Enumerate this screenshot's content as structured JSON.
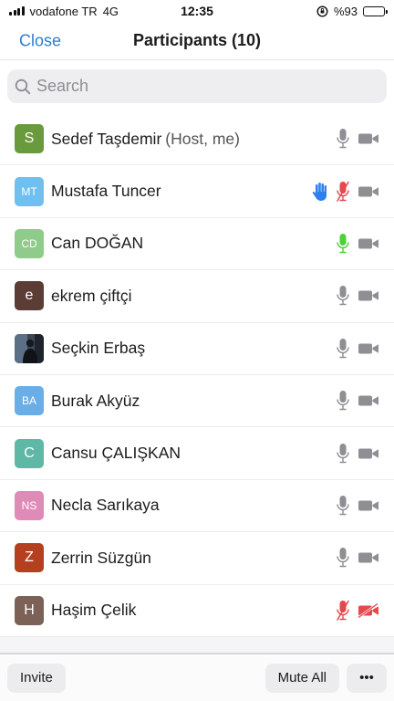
{
  "status_bar": {
    "carrier": "vodafone TR",
    "network": "4G",
    "time": "12:35",
    "battery": "%93",
    "battery_level": 0.93
  },
  "nav": {
    "close_label": "Close",
    "title": "Participants (10)"
  },
  "search": {
    "placeholder": "Search"
  },
  "participants": [
    {
      "initials": "S",
      "name": "Sedef Taşdemir",
      "suffix": "(Host, me)",
      "avatar_color": "#6a9a3e",
      "mic": "on",
      "video": "on",
      "hand": false
    },
    {
      "initials": "MT",
      "name": "Mustafa Tuncer",
      "suffix": "",
      "avatar_color": "#6fc0ee",
      "mic": "muted",
      "video": "on",
      "hand": true
    },
    {
      "initials": "CD",
      "name": "Can DOĞAN",
      "suffix": "",
      "avatar_color": "#8fcb8a",
      "mic": "speaking",
      "video": "on",
      "hand": false
    },
    {
      "initials": "e",
      "name": "ekrem çiftçi",
      "suffix": "",
      "avatar_color": "#5b3d36",
      "mic": "on",
      "video": "on",
      "hand": false
    },
    {
      "initials": "",
      "name": "Seçkin Erbaş",
      "suffix": "",
      "avatar_color": "#2e3540",
      "mic": "on",
      "video": "on",
      "hand": false
    },
    {
      "initials": "BA",
      "name": "Burak Akyüz",
      "suffix": "",
      "avatar_color": "#6aaee8",
      "mic": "on",
      "video": "on",
      "hand": false
    },
    {
      "initials": "C",
      "name": "Cansu ÇALIŞKAN",
      "suffix": "",
      "avatar_color": "#5fb8a6",
      "mic": "on",
      "video": "on",
      "hand": false
    },
    {
      "initials": "NS",
      "name": "Necla Sarıkaya",
      "suffix": "",
      "avatar_color": "#df8bb7",
      "mic": "on",
      "video": "on",
      "hand": false
    },
    {
      "initials": "Z",
      "name": "Zerrin Süzgün",
      "suffix": "",
      "avatar_color": "#b5401f",
      "mic": "on",
      "video": "on",
      "hand": false
    },
    {
      "initials": "H",
      "name": "Haşim Çelik",
      "suffix": "",
      "avatar_color": "#7b6156",
      "mic": "muted",
      "video": "off",
      "hand": false
    }
  ],
  "toolbar": {
    "invite_label": "Invite",
    "mute_all_label": "Mute All",
    "more_label": "•••"
  },
  "colors": {
    "accent": "#2d7dd2",
    "icon_gray": "#8e8e93",
    "muted_red": "#e5484d",
    "speaking_green": "#4cd137",
    "hand_blue": "#2f80ed"
  }
}
